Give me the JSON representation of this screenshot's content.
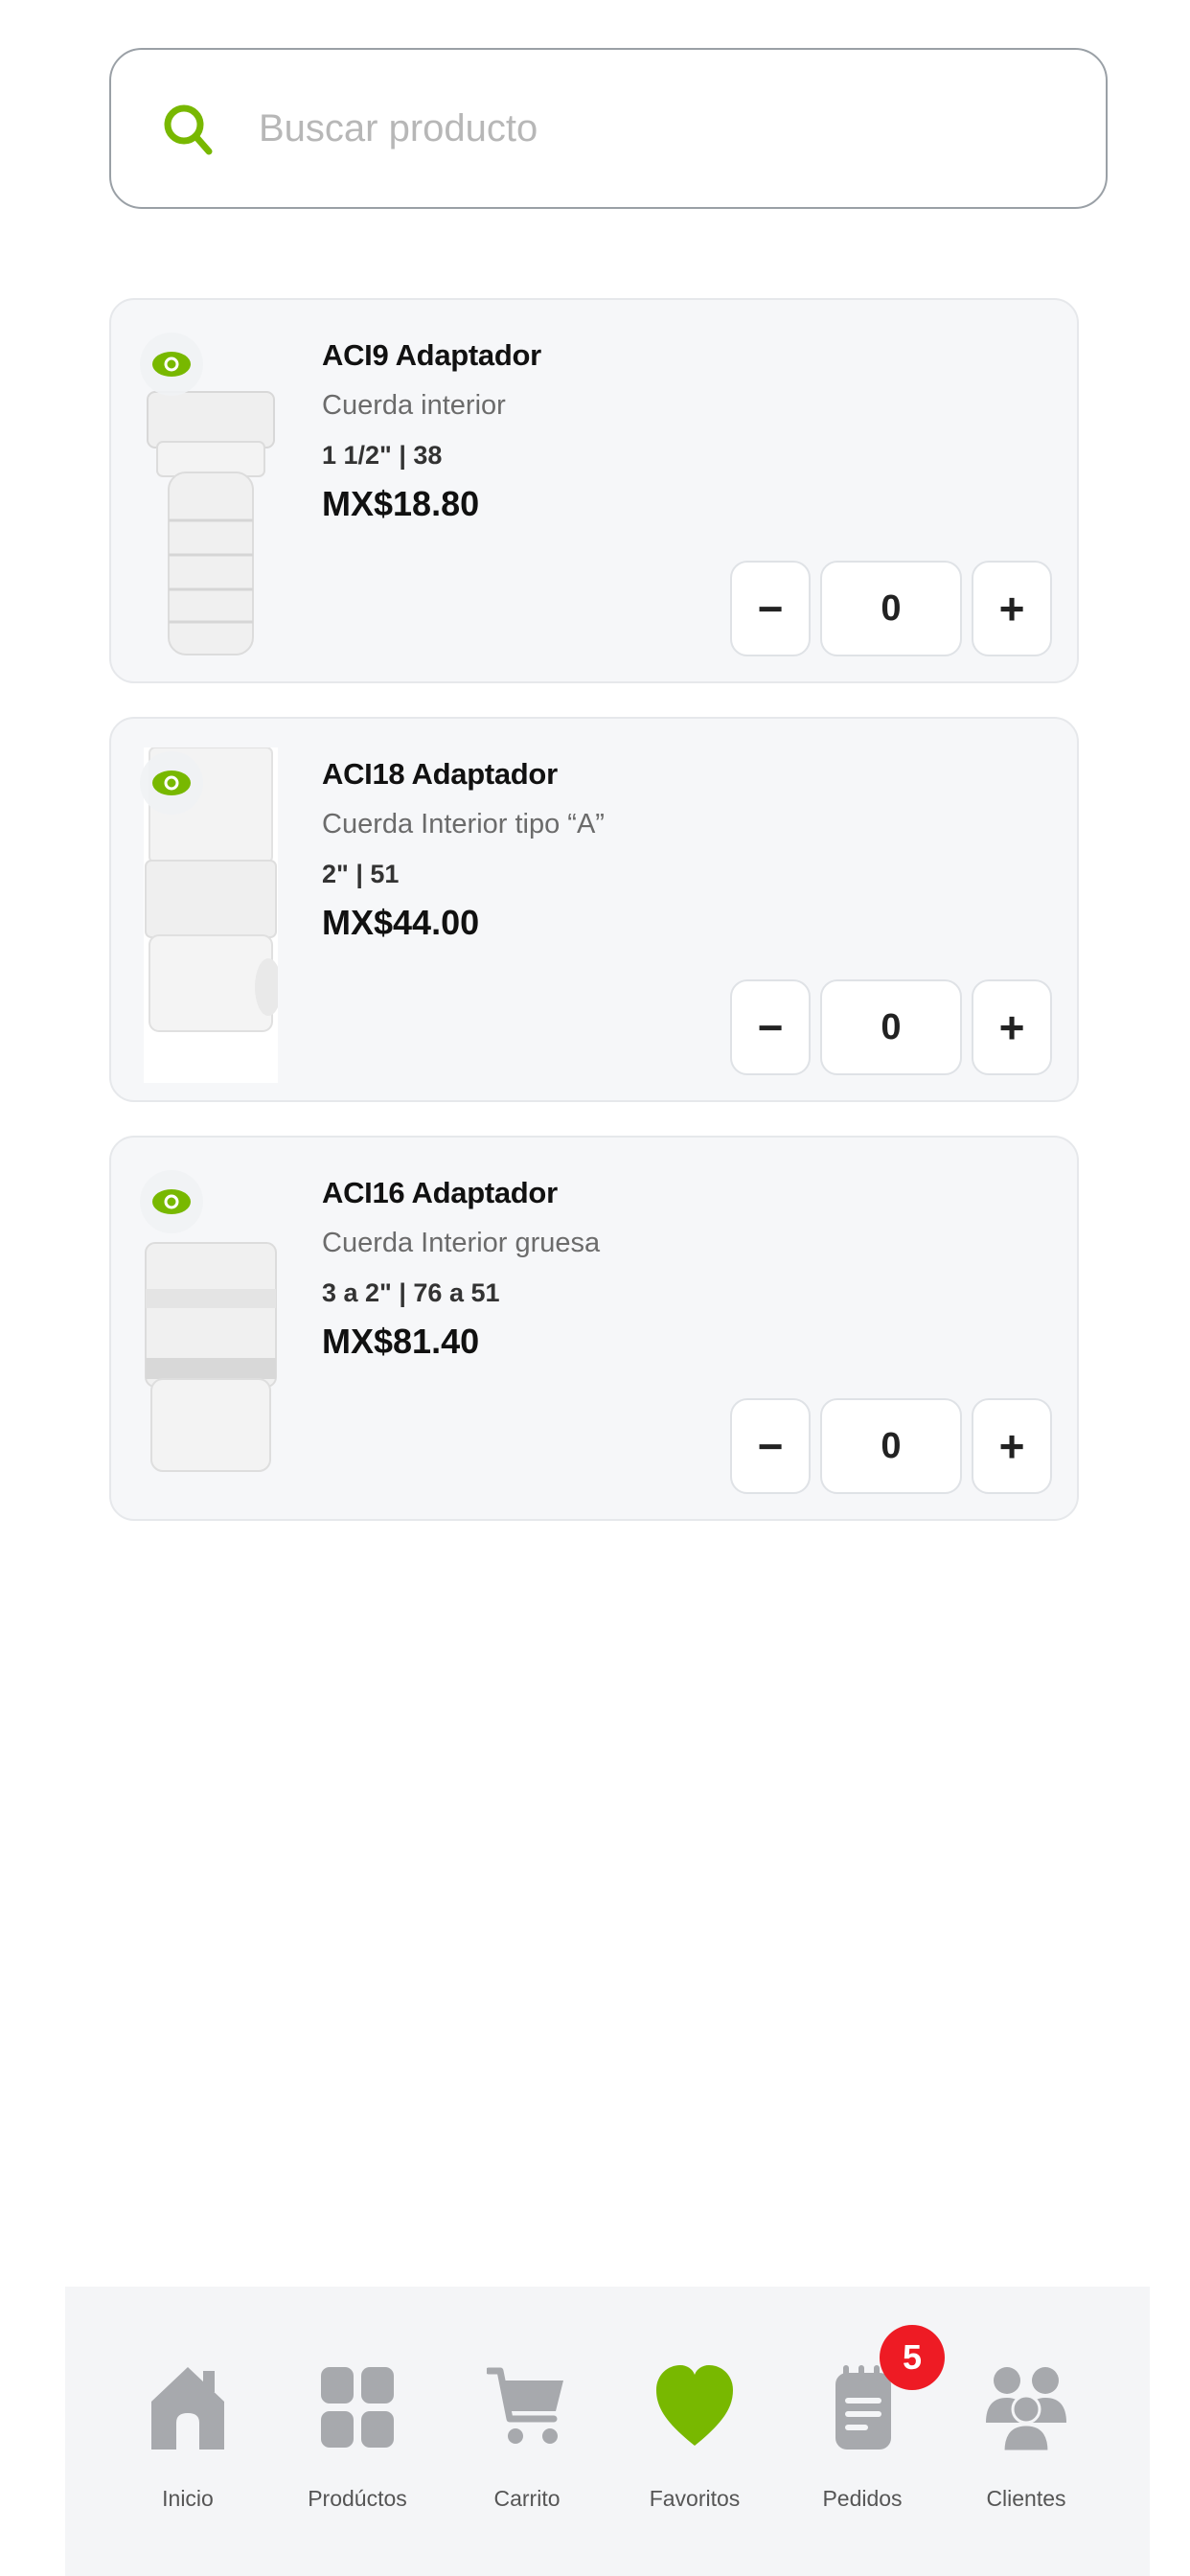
{
  "search": {
    "placeholder": "Buscar producto",
    "value": ""
  },
  "products": [
    {
      "name": "ACI9 Adaptador",
      "description": "Cuerda interior",
      "size": "1 1/2\" | 38",
      "price": "MX$18.80",
      "quantity": "0"
    },
    {
      "name": "ACI18 Adaptador",
      "description": "Cuerda Interior tipo “A”",
      "size": "2\" | 51",
      "price": "MX$44.00",
      "quantity": "0"
    },
    {
      "name": "ACI16 Adaptador",
      "description": "Cuerda Interior gruesa",
      "size": "3 a 2\" | 76 a 51",
      "price": "MX$81.40",
      "quantity": "0"
    }
  ],
  "qty_controls": {
    "minus": "−",
    "plus": "+"
  },
  "nav": {
    "items": [
      {
        "label": "Inicio",
        "icon": "home-icon"
      },
      {
        "label": "Prodúctos",
        "icon": "grid-icon"
      },
      {
        "label": "Carrito",
        "icon": "cart-icon"
      },
      {
        "label": "Favoritos",
        "icon": "heart-icon",
        "active": true
      },
      {
        "label": "Pedidos",
        "icon": "orders-icon",
        "badge": "5"
      },
      {
        "label": "Clientes",
        "icon": "users-icon"
      }
    ]
  },
  "colors": {
    "accent": "#78b800",
    "icon_inactive": "#a7a9ad",
    "badge": "#ee1b24",
    "card_bg": "#f6f7f9"
  }
}
